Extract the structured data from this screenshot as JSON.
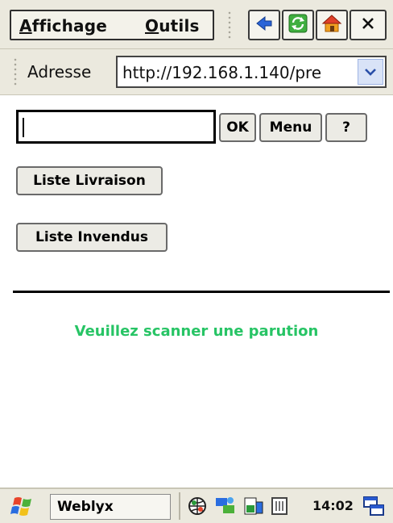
{
  "menubar": {
    "view_label": "Affichage",
    "view_hotkey": "A",
    "view_rest": "ffichage",
    "tools_hotkey": "O",
    "tools_rest": "utils",
    "tools_label": "Outils",
    "toolbar_icons": [
      "back-icon",
      "refresh-icon",
      "home-icon",
      "close-icon"
    ]
  },
  "address": {
    "label": "Adresse",
    "url": "http://192.168.1.140/pre"
  },
  "form": {
    "scan_value": "",
    "ok_label": "OK",
    "menu_label": "Menu",
    "help_label": "?"
  },
  "buttons": {
    "delivery_label": "Liste Livraison",
    "unsold_label": "Liste Invendus"
  },
  "message": {
    "text": "Veuillez scanner une parution",
    "color": "#27c465"
  },
  "taskbar": {
    "app_label": "Weblyx",
    "clock": "14:02",
    "tray_icons": [
      "network-globe-icon",
      "sync-icon",
      "battery-icon",
      "input-panel-icon"
    ]
  },
  "colors": {
    "chrome": "#ebe9de",
    "message": "#27c465",
    "dropdown": "#d9e3f7"
  }
}
